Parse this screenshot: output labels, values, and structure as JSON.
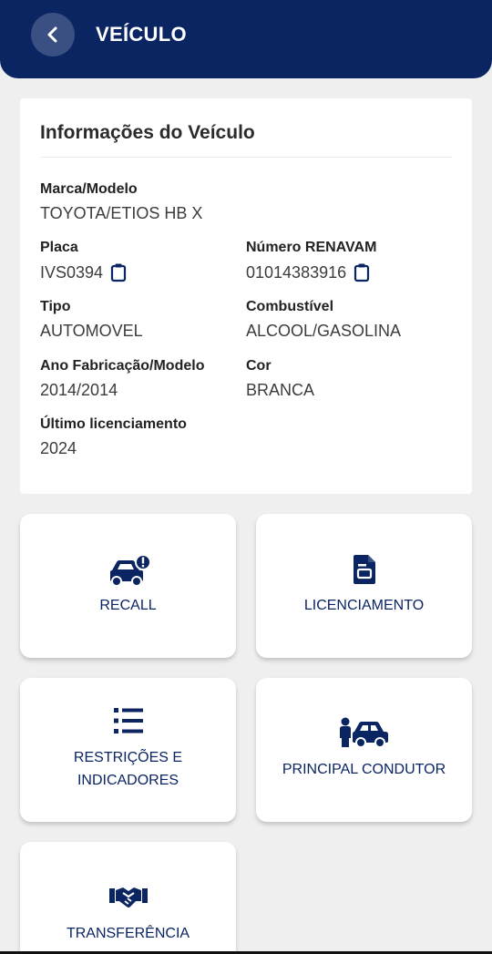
{
  "header": {
    "title": "VEÍCULO",
    "back_icon": "chevron-left-icon"
  },
  "vehicle_info": {
    "title": "Informações do Veículo",
    "marca_modelo": {
      "label": "Marca/Modelo",
      "value": "TOYOTA/ETIOS HB X"
    },
    "placa": {
      "label": "Placa",
      "value": "IVS0394"
    },
    "renavam": {
      "label": "Número RENAVAM",
      "value": "01014383916"
    },
    "tipo": {
      "label": "Tipo",
      "value": "AUTOMOVEL"
    },
    "combustivel": {
      "label": "Combustível",
      "value": "ALCOOL/GASOLINA"
    },
    "ano": {
      "label": "Ano Fabricação/Modelo",
      "value": "2014/2014"
    },
    "cor": {
      "label": "Cor",
      "value": "BRANCA"
    },
    "licenciamento": {
      "label": "Último licenciamento",
      "value": "2024"
    }
  },
  "tiles": {
    "recall": {
      "label": "RECALL",
      "icon": "car-alert-icon"
    },
    "licenciamento": {
      "label": "LICENCIAMENTO",
      "icon": "document-icon"
    },
    "restricoes": {
      "label_line1": "RESTRIÇÕES E",
      "label_line2": "INDICADORES",
      "icon": "list-icon"
    },
    "condutor": {
      "label": "PRINCIPAL CONDUTOR",
      "icon": "driver-car-icon"
    },
    "transferencia": {
      "label": "TRANSFERÊNCIA",
      "icon": "handshake-icon"
    }
  },
  "colors": {
    "primary": "#0b2462",
    "background": "#efefef",
    "card": "#ffffff"
  }
}
